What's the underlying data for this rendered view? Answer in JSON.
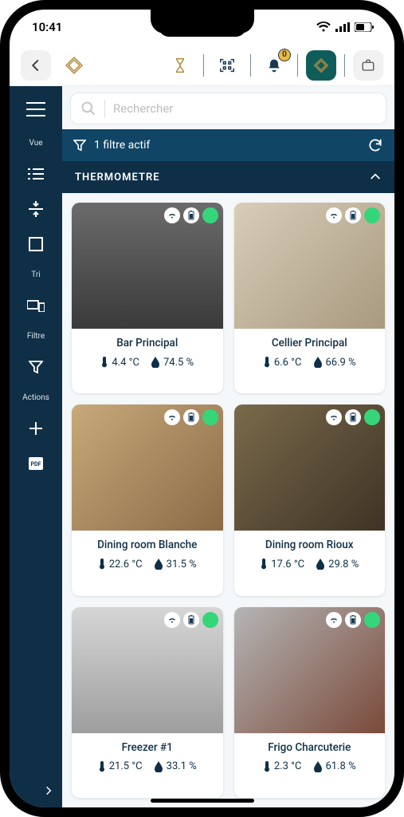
{
  "status": {
    "time": "10:41",
    "notif_count": "0"
  },
  "search": {
    "placeholder": "Rechercher"
  },
  "filterbar": {
    "label": "1 filtre actif"
  },
  "section": {
    "title": "THERMOMETRE"
  },
  "sidebar": {
    "items": [
      {
        "label": "Vue"
      },
      {
        "label": ""
      },
      {
        "label": ""
      },
      {
        "label": ""
      },
      {
        "label": "Tri"
      },
      {
        "label": ""
      },
      {
        "label": "Filtre"
      },
      {
        "label": ""
      },
      {
        "label": "Actions"
      },
      {
        "label": ""
      },
      {
        "label": ""
      }
    ]
  },
  "cards": [
    {
      "name": "Bar Principal",
      "temp": "4.4 °C",
      "humidity": "74.5 %"
    },
    {
      "name": "Cellier Principal",
      "temp": "6.6 °C",
      "humidity": "66.9 %"
    },
    {
      "name": "Dining room Blanche",
      "temp": "22.6 °C",
      "humidity": "31.5 %"
    },
    {
      "name": "Dining room Rioux",
      "temp": "17.6 °C",
      "humidity": "29.8 %"
    },
    {
      "name": "Freezer #1",
      "temp": "21.5 °C",
      "humidity": "33.1 %"
    },
    {
      "name": "Frigo Charcuterie",
      "temp": "2.3 °C",
      "humidity": "61.8 %"
    }
  ]
}
